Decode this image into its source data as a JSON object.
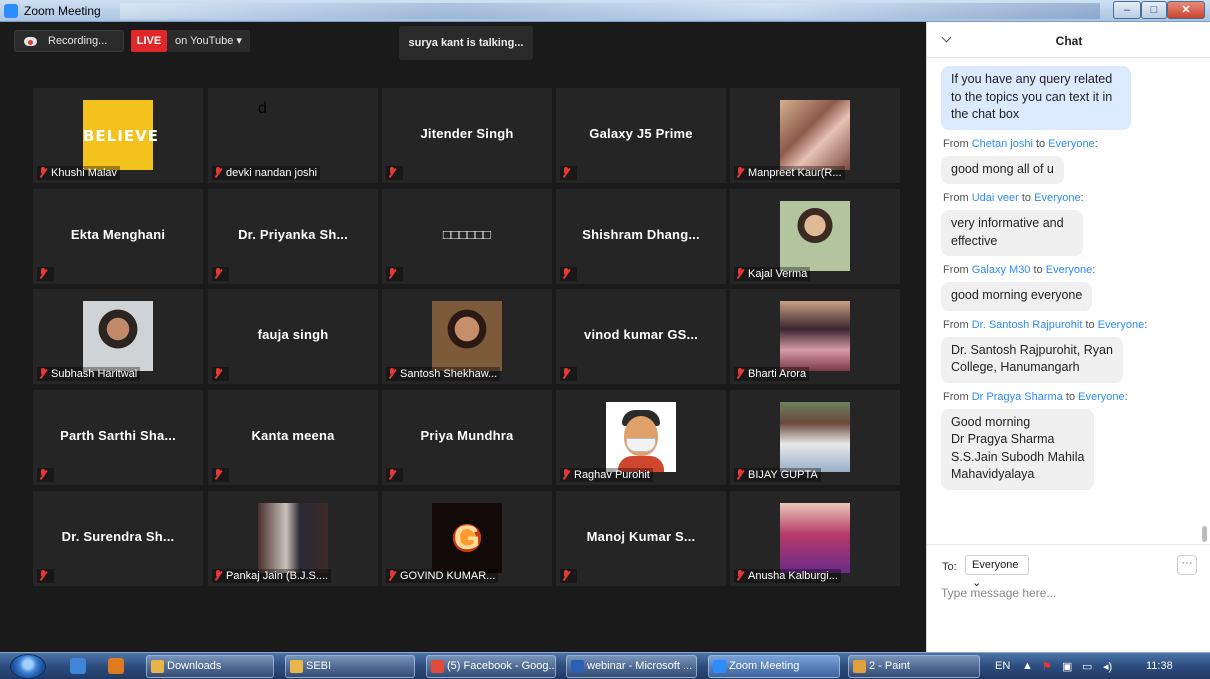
{
  "window": {
    "title": "Zoom Meeting",
    "minimize": "–",
    "maximize": "□",
    "close": "✕"
  },
  "toolbar": {
    "recording_label": "Recording...",
    "live_label": "LIVE",
    "live_target": "on YouTube ▾",
    "talking": "surya kant is talking..."
  },
  "tiles": [
    {
      "name": "Khushi Malav",
      "display": "photo",
      "photo": "believe",
      "photo_text": "BELIEVE"
    },
    {
      "name": "devki nandan joshi",
      "display": "photo",
      "photo": "letter-d",
      "photo_text": "d"
    },
    {
      "name": "Jitender Singh",
      "display": "name"
    },
    {
      "name": "Galaxy J5 Prime",
      "display": "name"
    },
    {
      "name": "Manpreet Kaur(R...",
      "display": "photo",
      "photo": "women"
    },
    {
      "name": "Ekta Menghani",
      "display": "name"
    },
    {
      "name": "Dr. Priyanka Sh...",
      "display": "name"
    },
    {
      "name": "□□□□□□",
      "display": "name"
    },
    {
      "name": "Shishram Dhang...",
      "display": "name"
    },
    {
      "name": "Kajal Verma",
      "display": "photo",
      "photo": "kajal"
    },
    {
      "name": "Subhash Haritwal",
      "display": "photo",
      "photo": "man1"
    },
    {
      "name": "fauja singh",
      "display": "name"
    },
    {
      "name": "Santosh Shekhaw...",
      "display": "photo",
      "photo": "santosh"
    },
    {
      "name": "vinod kumar GS...",
      "display": "name"
    },
    {
      "name": "Bharti Arora",
      "display": "photo",
      "photo": "bharti"
    },
    {
      "name": "Parth Sarthi Sha...",
      "display": "name"
    },
    {
      "name": "Kanta meena",
      "display": "name"
    },
    {
      "name": "Priya Mundhra",
      "display": "name"
    },
    {
      "name": "Raghav Purohit",
      "display": "photo",
      "photo": "raghav"
    },
    {
      "name": "BIJAY GUPTA",
      "display": "photo",
      "photo": "bijay"
    },
    {
      "name": "Dr. Surendra Sh...",
      "display": "name"
    },
    {
      "name": "Pankaj Jain (B.J.S....",
      "display": "photo",
      "photo": "pankaj"
    },
    {
      "name": "GOVIND KUMAR...",
      "display": "photo",
      "photo": "govind",
      "photo_text": "G"
    },
    {
      "name": "Manoj Kumar S...",
      "display": "name"
    },
    {
      "name": "Anusha Kalburgi...",
      "display": "photo",
      "photo": "anusha"
    }
  ],
  "chat": {
    "title": "Chat",
    "messages": [
      {
        "from": "",
        "to": "",
        "text": "If you have any query related to the topics you can text it in the chat box",
        "highlight": true
      },
      {
        "from": "Chetan joshi",
        "to": "Everyone",
        "text": "good mong all of u"
      },
      {
        "from": "Udai veer",
        "to": "Everyone",
        "text": "very informative  and effective"
      },
      {
        "from": "Galaxy M30",
        "to": "Everyone",
        "text": "good morning everyone"
      },
      {
        "from": "Dr. Santosh Rajpurohit",
        "to": "Everyone",
        "text": "Dr. Santosh Rajpurohit, Ryan College, Hanumangarh"
      },
      {
        "from": "Dr Pragya Sharma",
        "to": "Everyone",
        "text": "Good morning\nDr Pragya Sharma\nS.S.Jain Subodh Mahila\nMahavidyalaya"
      }
    ],
    "from_word": "From",
    "to_word": "to",
    "to_label": "To:",
    "to_value": "Everyone ⌄",
    "more": "···",
    "input_placeholder": "Type message here..."
  },
  "taskbar": {
    "items": [
      {
        "label": "Downloads",
        "icon": "folder-icon",
        "color": "#e8b64a"
      },
      {
        "label": "SEBI",
        "icon": "folder-icon",
        "color": "#e8b64a"
      },
      {
        "label": "(5) Facebook - Goog...",
        "icon": "chrome-icon",
        "color": "#e14b3b"
      },
      {
        "label": "webinar - Microsoft ...",
        "icon": "word-icon",
        "color": "#2b5fb4"
      },
      {
        "label": "Zoom Meeting",
        "icon": "zoom-icon",
        "color": "#2d8cff"
      },
      {
        "label": "2 - Paint",
        "icon": "paint-icon",
        "color": "#e0a040"
      }
    ],
    "lang": "EN",
    "clock": "11:38"
  }
}
